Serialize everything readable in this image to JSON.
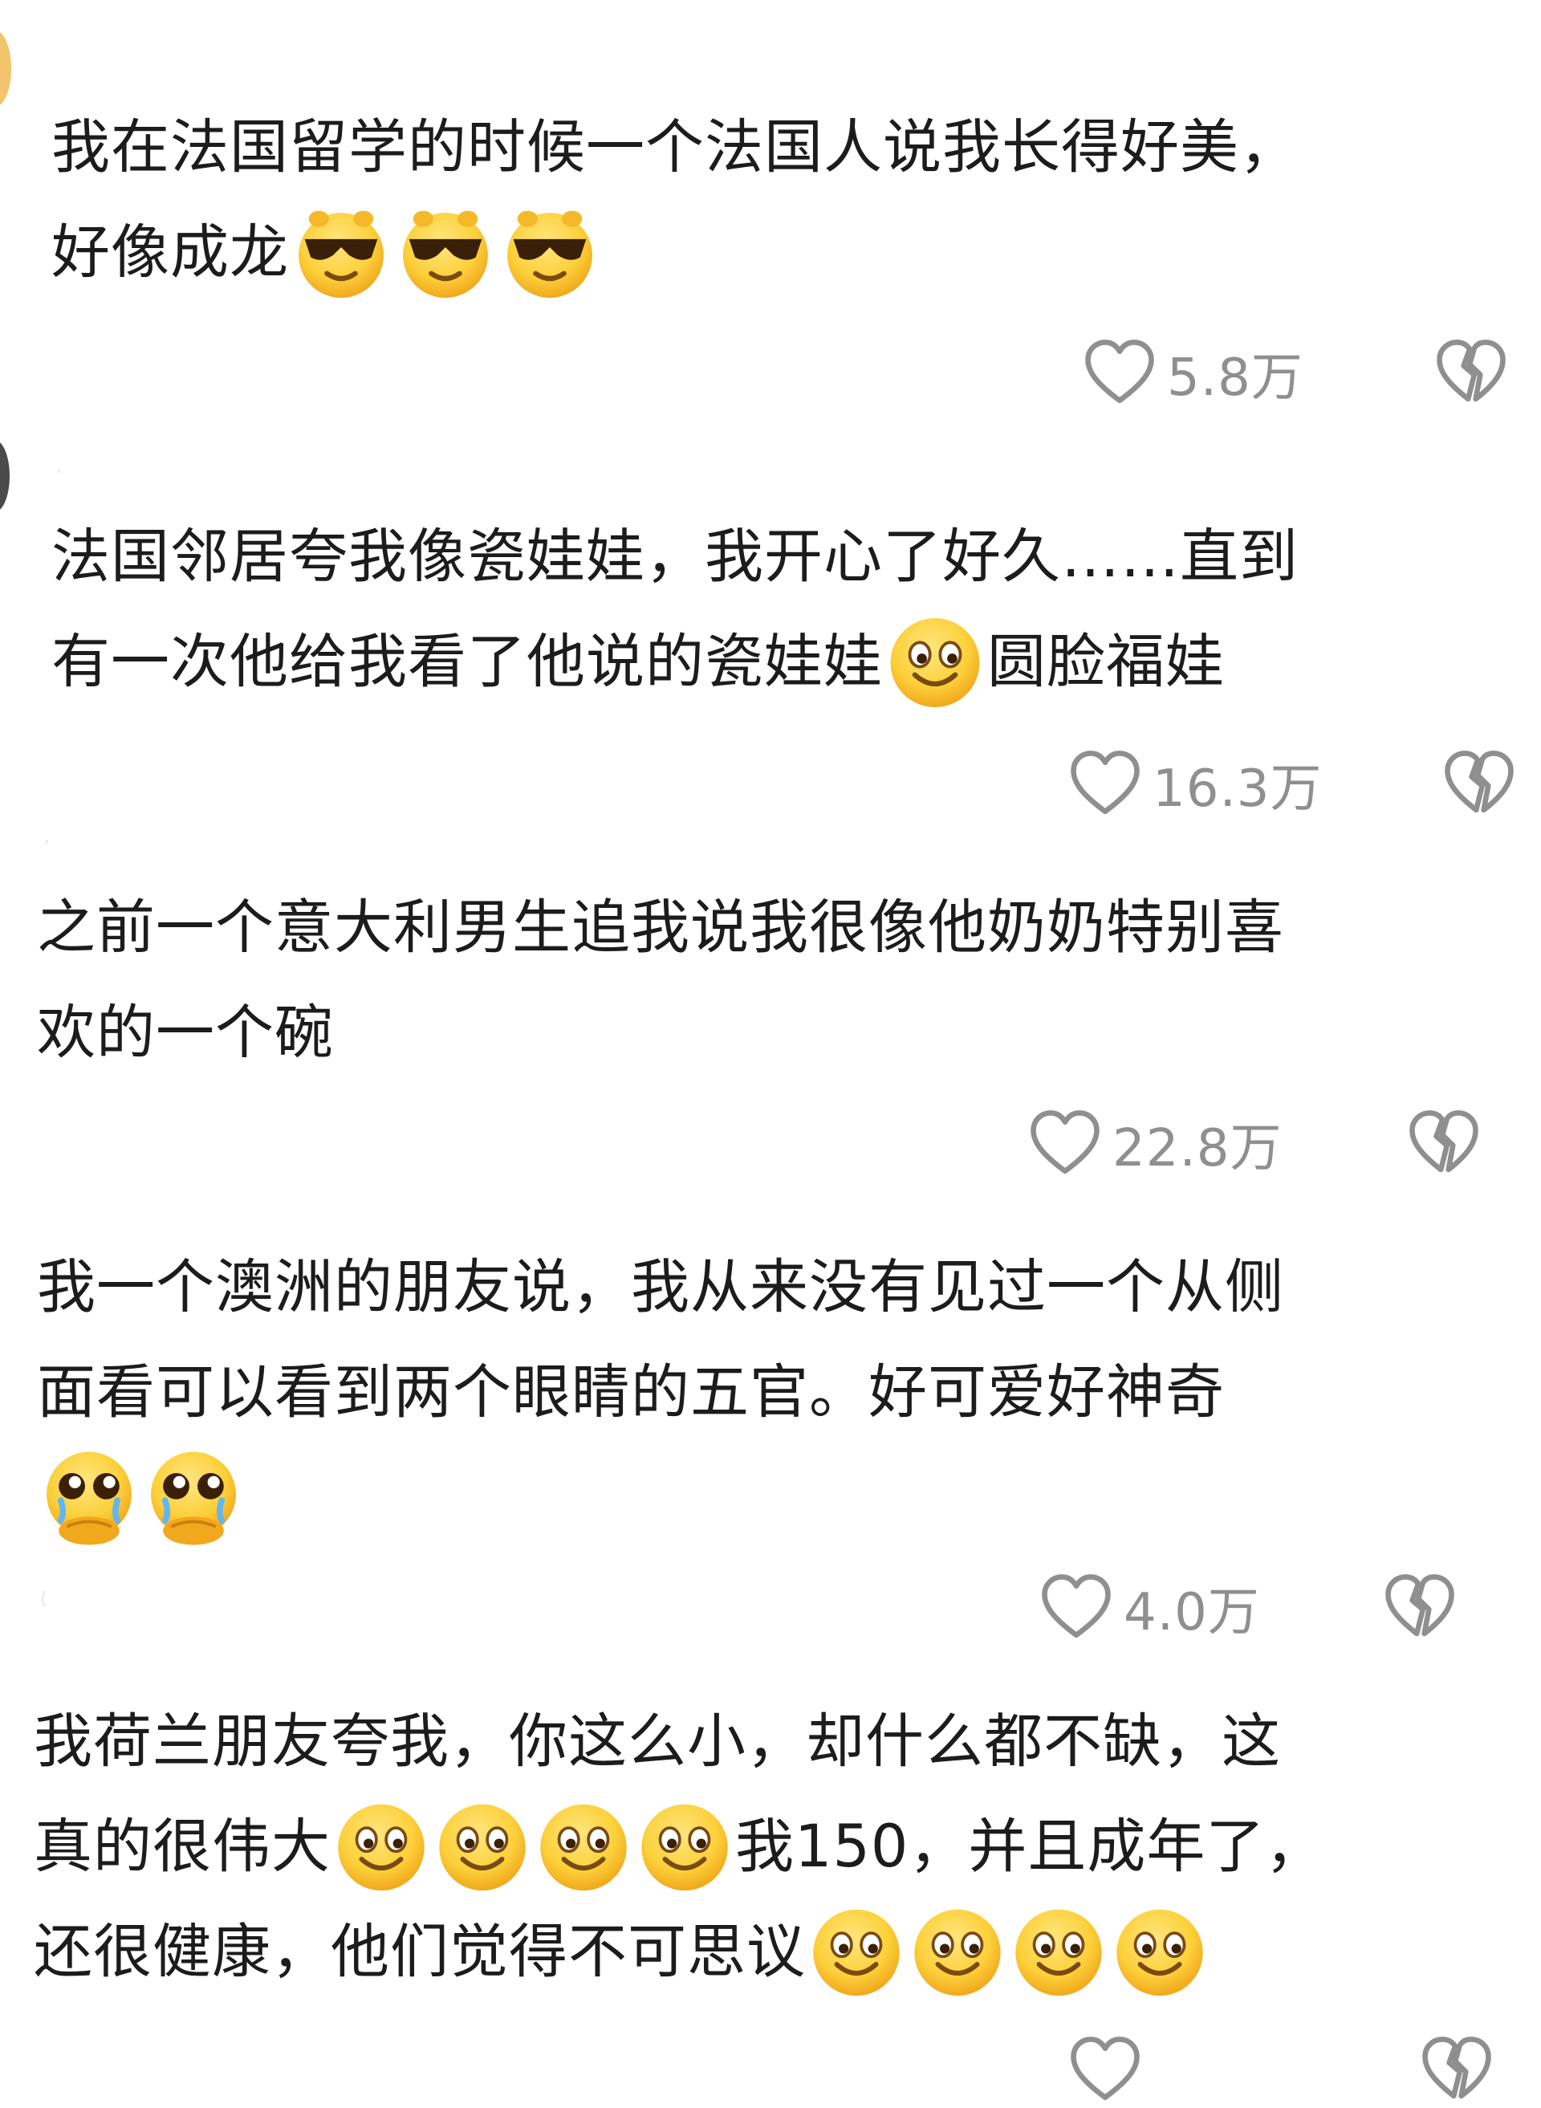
{
  "comments": [
    {
      "lines": [
        "我在法国留学的时候一个法国人说我长得好美，",
        "好像成龙"
      ],
      "likes": "5.8万",
      "emojis": [
        "sunglasses-emoji",
        "sunglasses-emoji",
        "sunglasses-emoji"
      ]
    },
    {
      "lines": [
        "法国邻居夸我像瓷娃娃，我开心了好久……直到",
        "有一次他给我看了他说的瓷娃娃",
        "圆脸福娃"
      ],
      "likes": "16.3万",
      "emojis": [
        "smiling-face-emoji"
      ]
    },
    {
      "lines": [
        "之前一个意大利男生追我说我很像他奶奶特别喜",
        "欢的一个碗"
      ],
      "likes": "22.8万",
      "emojis": []
    },
    {
      "lines": [
        "我一个澳洲的朋友说，我从来没有见过一个从侧",
        "面看可以看到两个眼睛的五官。好可爱好神奇"
      ],
      "likes": "4.0万",
      "emojis": [
        "pleading-face-emoji",
        "pleading-face-emoji"
      ]
    },
    {
      "lines": [
        "我荷兰朋友夸我，你这么小，却什么都不缺，这",
        "真的很伟大",
        "我150，并且成年了，",
        "还很健康，他们觉得不可思议"
      ],
      "emojis": [
        "smiling-face-emoji",
        "smiling-face-emoji",
        "smiling-face-emoji",
        "smiling-face-emoji"
      ]
    }
  ],
  "colors": {
    "text": "#1c1c1c",
    "muted": "#8f8f8f",
    "emoji_yellow": "#f7c52c"
  },
  "icons": {
    "like": "heart-outline-icon",
    "dislike": "broken-heart-outline-icon"
  }
}
